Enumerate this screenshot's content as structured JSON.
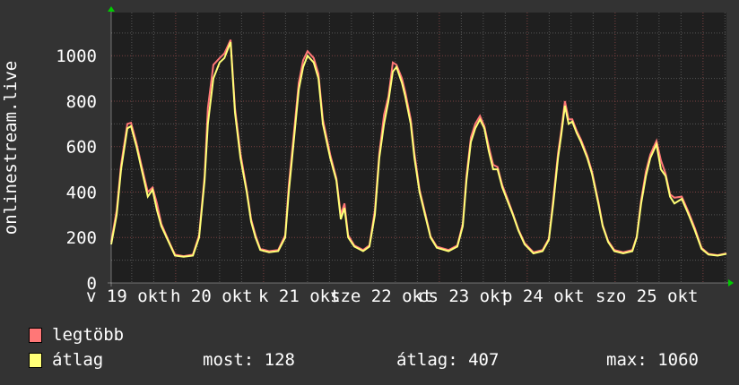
{
  "chart_data": {
    "type": "line",
    "ylabel": "onlinestream.live",
    "ylim": [
      0,
      1190
    ],
    "xlim_hours": [
      0,
      168
    ],
    "yticks": [
      "0",
      "200",
      "400",
      "600",
      "800",
      "1000"
    ],
    "xtick_labels": [
      "v 19 okt",
      "h 20 okt",
      "k 21 okt",
      "sze 22 okt",
      "cs 23 okt",
      "p 24 okt",
      "szo 25 okt"
    ],
    "grid": true,
    "colors": {
      "max": "#ff7777",
      "avg": "#ffff77"
    },
    "series_names": {
      "max": "legtöbb",
      "avg": "átlag"
    },
    "points_hour_avg_max": [
      [
        0,
        170,
        180
      ],
      [
        1.5,
        300,
        320
      ],
      [
        2.7,
        500,
        520
      ],
      [
        4.4,
        680,
        700
      ],
      [
        5.4,
        690,
        705
      ],
      [
        6.9,
        600,
        615
      ],
      [
        8.3,
        500,
        515
      ],
      [
        10,
        380,
        400
      ],
      [
        11.3,
        410,
        420
      ],
      [
        12.5,
        320,
        350
      ],
      [
        13.7,
        250,
        260
      ],
      [
        15.7,
        180,
        185
      ],
      [
        17.4,
        120,
        125
      ],
      [
        19.8,
        115,
        118
      ],
      [
        22.3,
        120,
        125
      ],
      [
        24,
        200,
        210
      ],
      [
        25.5,
        450,
        470
      ],
      [
        26.4,
        700,
        770
      ],
      [
        27.9,
        900,
        960
      ],
      [
        29.6,
        970,
        990
      ],
      [
        30.9,
        990,
        1010
      ],
      [
        32.6,
        1060,
        1070
      ],
      [
        33.8,
        750,
        770
      ],
      [
        35.3,
        550,
        570
      ],
      [
        37,
        400,
        410
      ],
      [
        38.2,
        270,
        280
      ],
      [
        39.4,
        200,
        210
      ],
      [
        40.7,
        145,
        150
      ],
      [
        43.1,
        135,
        140
      ],
      [
        45.6,
        140,
        145
      ],
      [
        47.5,
        200,
        210
      ],
      [
        48.5,
        400,
        430
      ],
      [
        50,
        650,
        680
      ],
      [
        51.2,
        850,
        880
      ],
      [
        52.4,
        950,
        980
      ],
      [
        53.6,
        1000,
        1020
      ],
      [
        55.3,
        970,
        990
      ],
      [
        56.6,
        900,
        920
      ],
      [
        57.8,
        700,
        720
      ],
      [
        59.8,
        550,
        565
      ],
      [
        61.5,
        450,
        460
      ],
      [
        62.7,
        280,
        300
      ],
      [
        63.7,
        330,
        350
      ],
      [
        64.7,
        200,
        210
      ],
      [
        66.4,
        160,
        165
      ],
      [
        68.8,
        140,
        145
      ],
      [
        70.5,
        160,
        165
      ],
      [
        72,
        300,
        320
      ],
      [
        73.2,
        550,
        570
      ],
      [
        74.5,
        700,
        740
      ],
      [
        75.7,
        800,
        820
      ],
      [
        76.9,
        930,
        970
      ],
      [
        77.9,
        950,
        960
      ],
      [
        79.4,
        880,
        900
      ],
      [
        80.3,
        820,
        840
      ],
      [
        81.8,
        700,
        720
      ],
      [
        82.8,
        550,
        570
      ],
      [
        84.2,
        400,
        410
      ],
      [
        85.7,
        300,
        310
      ],
      [
        87.2,
        200,
        205
      ],
      [
        88.9,
        155,
        160
      ],
      [
        92.1,
        140,
        145
      ],
      [
        94.5,
        160,
        165
      ],
      [
        96,
        250,
        260
      ],
      [
        97,
        450,
        470
      ],
      [
        98.2,
        620,
        640
      ],
      [
        99.4,
        680,
        700
      ],
      [
        100.7,
        720,
        735
      ],
      [
        101.9,
        680,
        690
      ],
      [
        103.1,
        580,
        600
      ],
      [
        104.3,
        500,
        520
      ],
      [
        105.5,
        500,
        510
      ],
      [
        106.8,
        420,
        430
      ],
      [
        108,
        370,
        380
      ],
      [
        109.7,
        300,
        305
      ],
      [
        111.2,
        230,
        235
      ],
      [
        112.9,
        170,
        175
      ],
      [
        115.3,
        130,
        135
      ],
      [
        117.8,
        140,
        145
      ],
      [
        119.5,
        190,
        195
      ],
      [
        120.7,
        350,
        370
      ],
      [
        122,
        550,
        570
      ],
      [
        122.9,
        650,
        670
      ],
      [
        123.9,
        780,
        800
      ],
      [
        124.9,
        700,
        720
      ],
      [
        125.9,
        710,
        720
      ],
      [
        127.1,
        660,
        670
      ],
      [
        128.3,
        620,
        630
      ],
      [
        130,
        550,
        560
      ],
      [
        131.3,
        480,
        490
      ],
      [
        133,
        350,
        360
      ],
      [
        134.2,
        250,
        255
      ],
      [
        135.7,
        180,
        185
      ],
      [
        137.4,
        140,
        145
      ],
      [
        139.8,
        130,
        135
      ],
      [
        142.3,
        140,
        145
      ],
      [
        143.5,
        200,
        205
      ],
      [
        144.7,
        350,
        365
      ],
      [
        146,
        470,
        490
      ],
      [
        147.2,
        550,
        565
      ],
      [
        148.9,
        610,
        625
      ],
      [
        150.1,
        500,
        540
      ],
      [
        151.4,
        470,
        480
      ],
      [
        152.6,
        380,
        390
      ],
      [
        153.8,
        350,
        375
      ],
      [
        155.8,
        370,
        380
      ],
      [
        157.7,
        300,
        310
      ],
      [
        159.4,
        230,
        240
      ],
      [
        161.2,
        150,
        155
      ],
      [
        163.1,
        125,
        128
      ],
      [
        165.6,
        120,
        122
      ],
      [
        168,
        128,
        130
      ]
    ]
  },
  "legend": {
    "max_label": "legtöbb",
    "avg_label": "átlag",
    "now": "most: 128",
    "avg": "átlag: 407",
    "max": "max: 1060"
  }
}
